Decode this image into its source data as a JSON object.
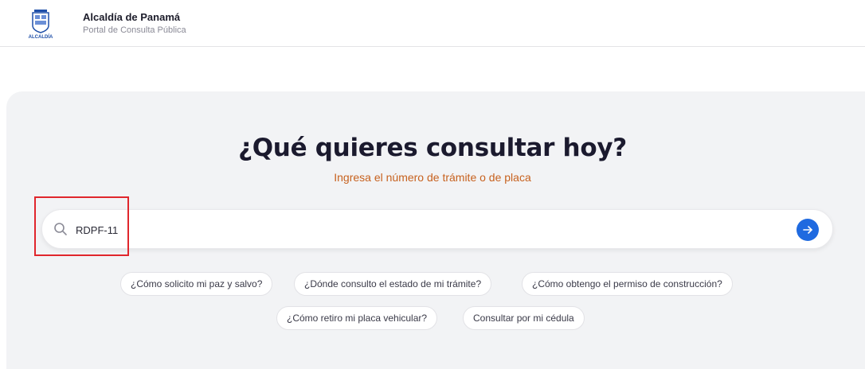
{
  "header": {
    "logo_text": "ALCALDÍA",
    "title": "Alcaldía de Panamá",
    "subtitle": "Portal de Consulta Pública"
  },
  "hero": {
    "title": "¿Qué quieres consultar hoy?",
    "subtitle": "Ingresa el número de trámite o de placa"
  },
  "search": {
    "value": "RDPF-11",
    "icon": "search-icon",
    "submit_icon": "arrow-right-icon"
  },
  "suggestions": [
    "¿Cómo solicito mi paz y salvo?",
    "¿Dónde consulto el estado de mi trámite?",
    "¿Cómo obtengo el permiso de construcción?",
    "¿Cómo retiro mi placa vehicular?",
    "Consultar por mi cédula"
  ],
  "colors": {
    "accent": "#1f6ae0",
    "subtitle": "#c7611e",
    "highlight": "#e0262c",
    "panel": "#f2f3f5"
  }
}
